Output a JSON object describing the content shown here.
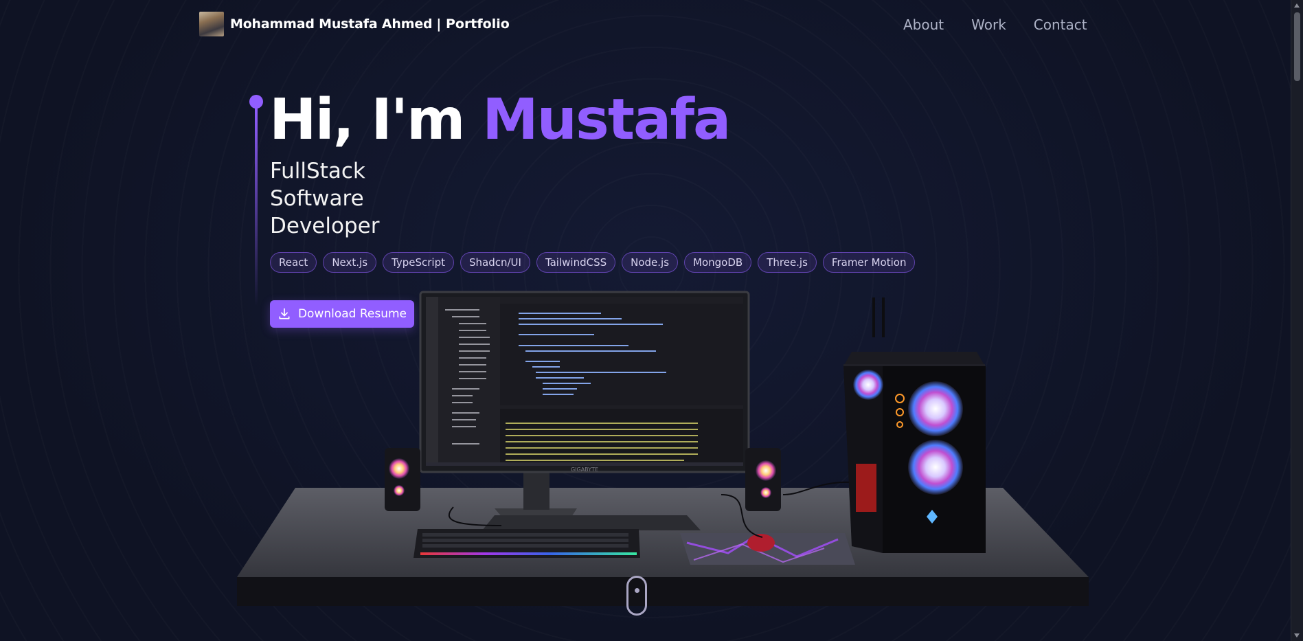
{
  "navbar": {
    "brand_name": "Mohammad Mustafa Ahmed",
    "brand_suffix": "| Portfolio",
    "avatar_icon": "profile-photo",
    "links": [
      {
        "label": "About"
      },
      {
        "label": "Work"
      },
      {
        "label": "Contact"
      }
    ]
  },
  "hero": {
    "greeting": "Hi, I'm",
    "name": "Mustafa",
    "subtitle_lines": [
      "FullStack",
      "Software",
      "Developer"
    ],
    "tech_stack": [
      "React",
      "Next.js",
      "TypeScript",
      "Shadcn/UI",
      "TailwindCSS",
      "Node.js",
      "MongoDB",
      "Three.js",
      "Framer Motion"
    ],
    "download_label": "Download Resume",
    "download_icon": "download-icon"
  },
  "scene": {
    "description_icon": "desk-computer-3d",
    "monitor_brand": "GIGABYTE"
  },
  "colors": {
    "accent": "#915eff",
    "background": "#0f1324",
    "nav_link": "#aeb3c7"
  }
}
